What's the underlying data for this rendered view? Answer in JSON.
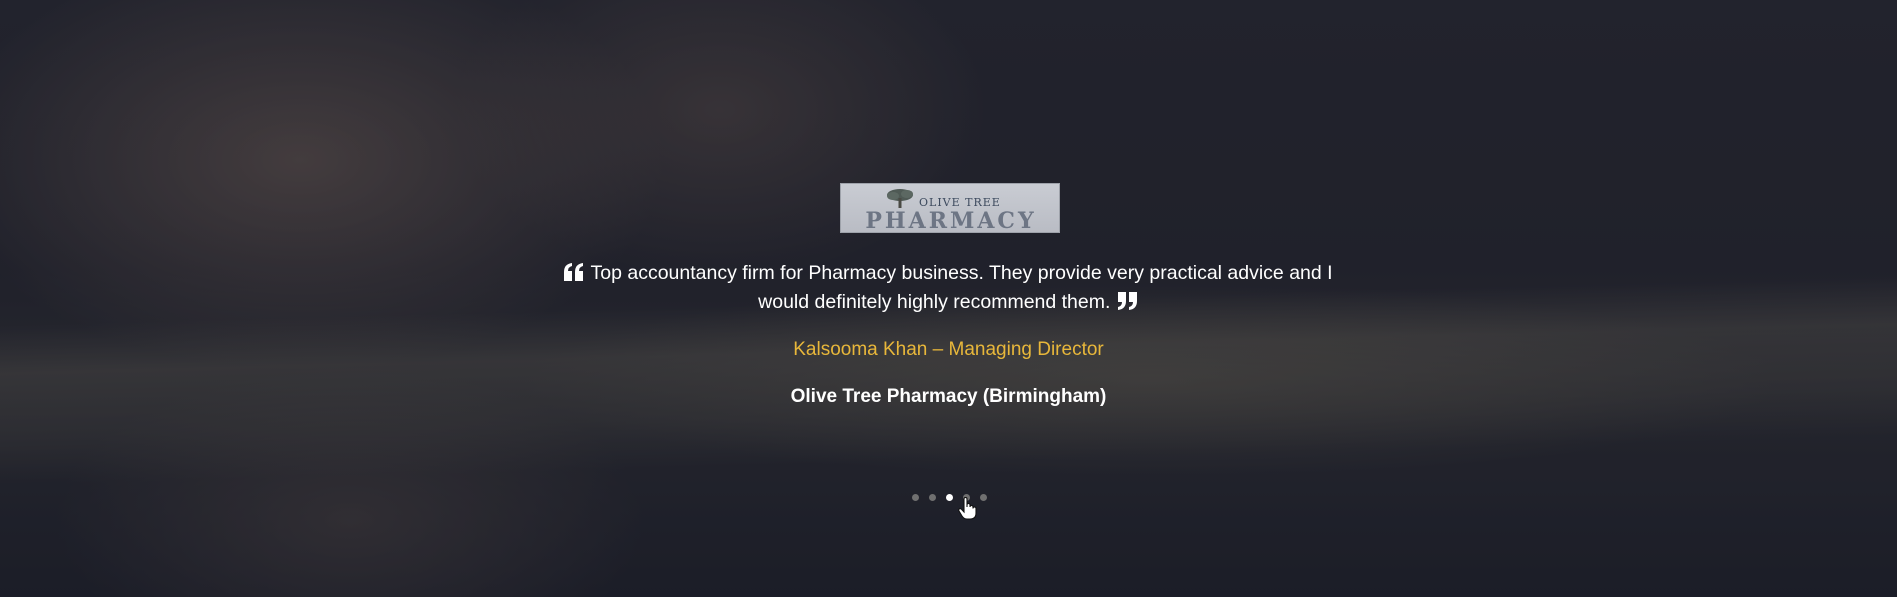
{
  "testimonial": {
    "logo": {
      "line1": "OLIVE TREE",
      "line2": "PHARMACY"
    },
    "quote": "Top accountancy firm for Pharmacy business. They provide very practical advice and I would definitely highly recommend them.",
    "author": "Kalsooma Khan – Managing Director",
    "company": "Olive Tree Pharmacy (Birmingham)",
    "open_quote_icon": "quote-left-icon",
    "close_quote_icon": "quote-right-icon"
  },
  "carousel": {
    "slide_count": 5,
    "active_index": 2
  },
  "colors": {
    "author": "#e8b73a",
    "text": "#ffffff",
    "dot_inactive": "#707070",
    "dot_active": "#ffffff"
  }
}
